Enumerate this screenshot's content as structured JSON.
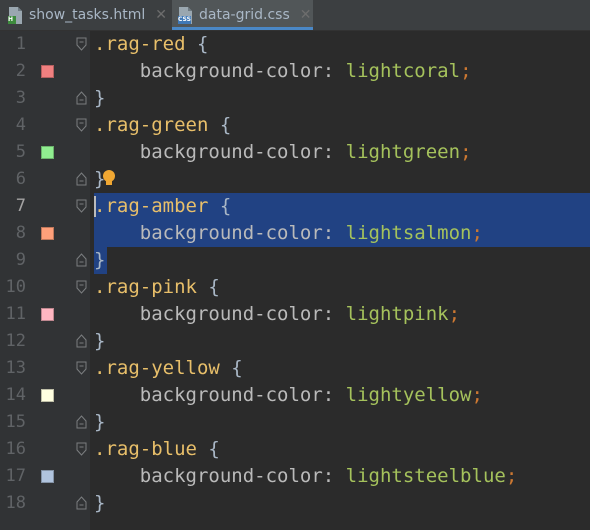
{
  "tabs": [
    {
      "label": "show_tasks.html",
      "icon": "html-file-icon",
      "badge": "H",
      "active": false
    },
    {
      "label": "data-grid.css",
      "icon": "css-file-icon",
      "badge": "CSS",
      "active": true
    }
  ],
  "colors": {
    "background": "#2b2b2b",
    "gutter": "#313335",
    "selection": "#214283",
    "selector": "#e8bf6a",
    "property": "#bababa",
    "value": "#a5c25c",
    "semicolon": "#cc7832",
    "active_tab_underline": "#4a88c7"
  },
  "editor": {
    "active_line": 7,
    "lines": [
      {
        "n": "1",
        "indent": "",
        "selector": ".rag-red",
        "open": " {",
        "prop": "",
        "val": "",
        "semi": "",
        "close": "",
        "swatch": ""
      },
      {
        "n": "2",
        "indent": "    ",
        "selector": "",
        "open": "",
        "prop": "background-color: ",
        "val": "lightcoral",
        "semi": ";",
        "close": "",
        "swatch": "lightcoral"
      },
      {
        "n": "3",
        "indent": "",
        "selector": "",
        "open": "",
        "prop": "",
        "val": "",
        "semi": "",
        "close": "}",
        "swatch": ""
      },
      {
        "n": "4",
        "indent": "",
        "selector": ".rag-green",
        "open": " {",
        "prop": "",
        "val": "",
        "semi": "",
        "close": "",
        "swatch": ""
      },
      {
        "n": "5",
        "indent": "    ",
        "selector": "",
        "open": "",
        "prop": "background-color: ",
        "val": "lightgreen",
        "semi": ";",
        "close": "",
        "swatch": "lightgreen"
      },
      {
        "n": "6",
        "indent": "",
        "selector": "",
        "open": "",
        "prop": "",
        "val": "",
        "semi": "",
        "close": "}",
        "swatch": ""
      },
      {
        "n": "7",
        "indent": "",
        "selector": ".rag-amber",
        "open": " {",
        "prop": "",
        "val": "",
        "semi": "",
        "close": "",
        "swatch": ""
      },
      {
        "n": "8",
        "indent": "    ",
        "selector": "",
        "open": "",
        "prop": "background-color: ",
        "val": "lightsalmon",
        "semi": ";",
        "close": "",
        "swatch": "lightsalmon"
      },
      {
        "n": "9",
        "indent": "",
        "selector": "",
        "open": "",
        "prop": "",
        "val": "",
        "semi": "",
        "close": "}",
        "swatch": ""
      },
      {
        "n": "10",
        "indent": "",
        "selector": ".rag-pink",
        "open": " {",
        "prop": "",
        "val": "",
        "semi": "",
        "close": "",
        "swatch": ""
      },
      {
        "n": "11",
        "indent": "    ",
        "selector": "",
        "open": "",
        "prop": "background-color: ",
        "val": "lightpink",
        "semi": ";",
        "close": "",
        "swatch": "lightpink"
      },
      {
        "n": "12",
        "indent": "",
        "selector": "",
        "open": "",
        "prop": "",
        "val": "",
        "semi": "",
        "close": "}",
        "swatch": ""
      },
      {
        "n": "13",
        "indent": "",
        "selector": ".rag-yellow",
        "open": " {",
        "prop": "",
        "val": "",
        "semi": "",
        "close": "",
        "swatch": ""
      },
      {
        "n": "14",
        "indent": "    ",
        "selector": "",
        "open": "",
        "prop": "background-color: ",
        "val": "lightyellow",
        "semi": ";",
        "close": "",
        "swatch": "lightyellow"
      },
      {
        "n": "15",
        "indent": "",
        "selector": "",
        "open": "",
        "prop": "",
        "val": "",
        "semi": "",
        "close": "}",
        "swatch": ""
      },
      {
        "n": "16",
        "indent": "",
        "selector": ".rag-blue",
        "open": " {",
        "prop": "",
        "val": "",
        "semi": "",
        "close": "",
        "swatch": ""
      },
      {
        "n": "17",
        "indent": "    ",
        "selector": "",
        "open": "",
        "prop": "background-color: ",
        "val": "lightsteelblue",
        "semi": ";",
        "close": "",
        "swatch": "lightsteelblue"
      },
      {
        "n": "18",
        "indent": "",
        "selector": "",
        "open": "",
        "prop": "",
        "val": "",
        "semi": "",
        "close": "}",
        "swatch": ""
      }
    ]
  }
}
